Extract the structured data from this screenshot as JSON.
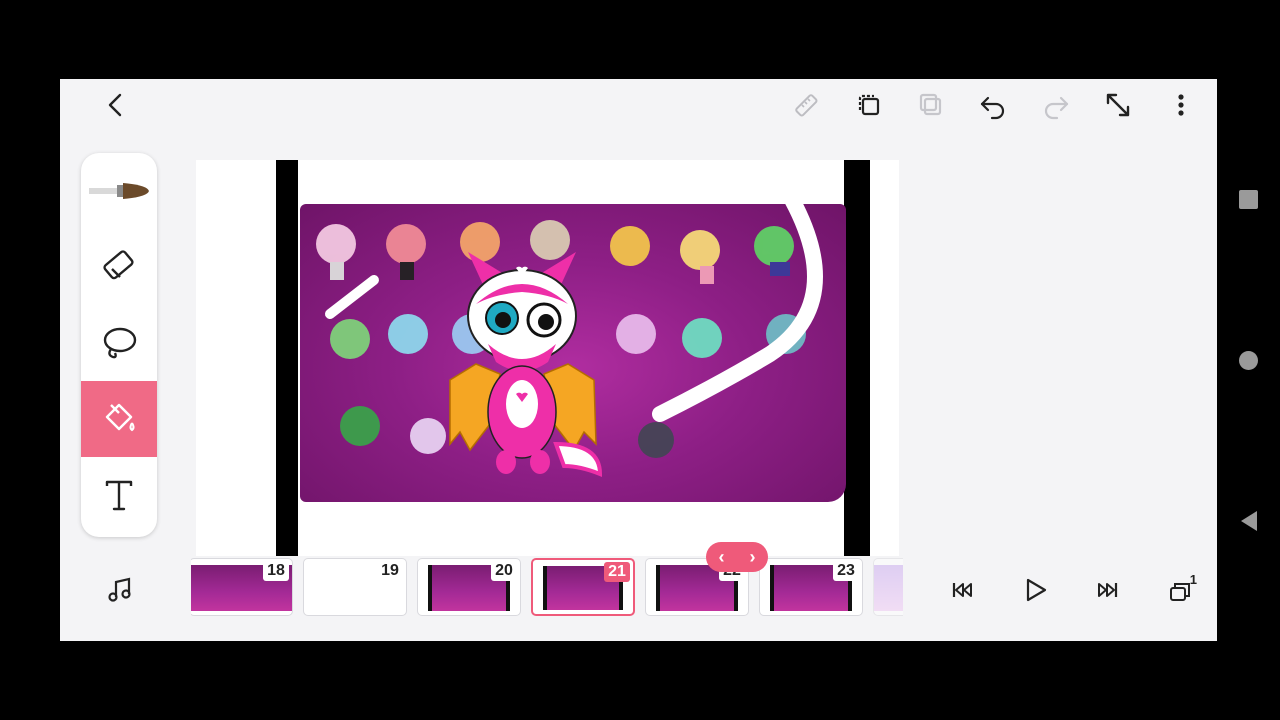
{
  "toolbar": {
    "icons": [
      "back-icon",
      "ruler-icon",
      "copy-frame-icon",
      "paste-frame-icon",
      "undo-icon",
      "redo-icon",
      "fullscreen-icon",
      "more-icon"
    ]
  },
  "tools": [
    "brush",
    "eraser",
    "lasso",
    "fill",
    "text"
  ],
  "active_tool": "fill",
  "timeline": {
    "frames": [
      {
        "number": "18",
        "blank": false
      },
      {
        "number": "19",
        "blank": true
      },
      {
        "number": "20",
        "blank": false
      },
      {
        "number": "21",
        "blank": false,
        "current": true
      },
      {
        "number": "22",
        "blank": false
      },
      {
        "number": "23",
        "blank": false
      }
    ],
    "nav_prev": "‹",
    "nav_next": "›",
    "layers_badge": "1"
  },
  "colors": {
    "accent": "#ef5a7a",
    "tool_active_bg": "#f06a86",
    "canvas_purple": "#8e1f86"
  }
}
